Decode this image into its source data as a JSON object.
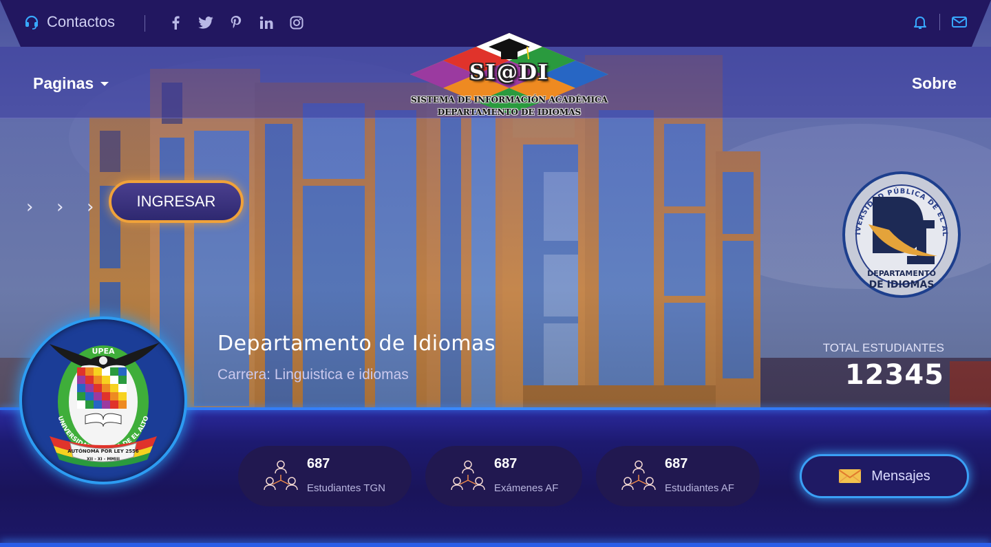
{
  "topbar": {
    "contact_label": "Contactos",
    "social_icons": [
      "facebook-icon",
      "twitter-icon",
      "pinterest-icon",
      "linkedin-icon",
      "instagram-icon"
    ],
    "icons_right": [
      "bell-icon",
      "mail-icon"
    ]
  },
  "nav": {
    "pages_label": "Paginas",
    "about_label": "Sobre"
  },
  "logo": {
    "title": "SI@DI",
    "line1": "SISTEMA DE INFORMACIÓN ACADÉMICA",
    "line2": "DEPARTAMENTO DE IDIOMAS"
  },
  "hero": {
    "ingresar_label": "INGRESAR",
    "department_title": "Departamento de Idiomas",
    "career_subtitle": "Carrera: Linguistica e idiomas",
    "total_label": "TOTAL ESTUDIANTES",
    "total_value": "12345"
  },
  "di_badge": {
    "ring_text": "UNIVERSIDAD PÚBLICA DE EL ALTO",
    "line1": "DEPARTAMENTO",
    "line2": "DE IDIOMAS"
  },
  "upea_logo": {
    "top": "UPEA",
    "ring": "UNIVERSIDAD PÚBLICA DE EL ALTO",
    "line1": "AUTÓNOMA POR LEY 2556",
    "line2": "XII - XI - MMIII"
  },
  "stats": [
    {
      "value": "687",
      "label": "Estudiantes TGN"
    },
    {
      "value": "687",
      "label": "Exámenes AF"
    },
    {
      "value": "687",
      "label": "Estudiantes AF"
    }
  ],
  "messages_label": "Mensajes",
  "colors": {
    "topbar_bg": "#221760",
    "accent_orange": "#f0a23a",
    "accent_blue": "#3aa0f6",
    "bottom_bg": "#1a145a"
  }
}
